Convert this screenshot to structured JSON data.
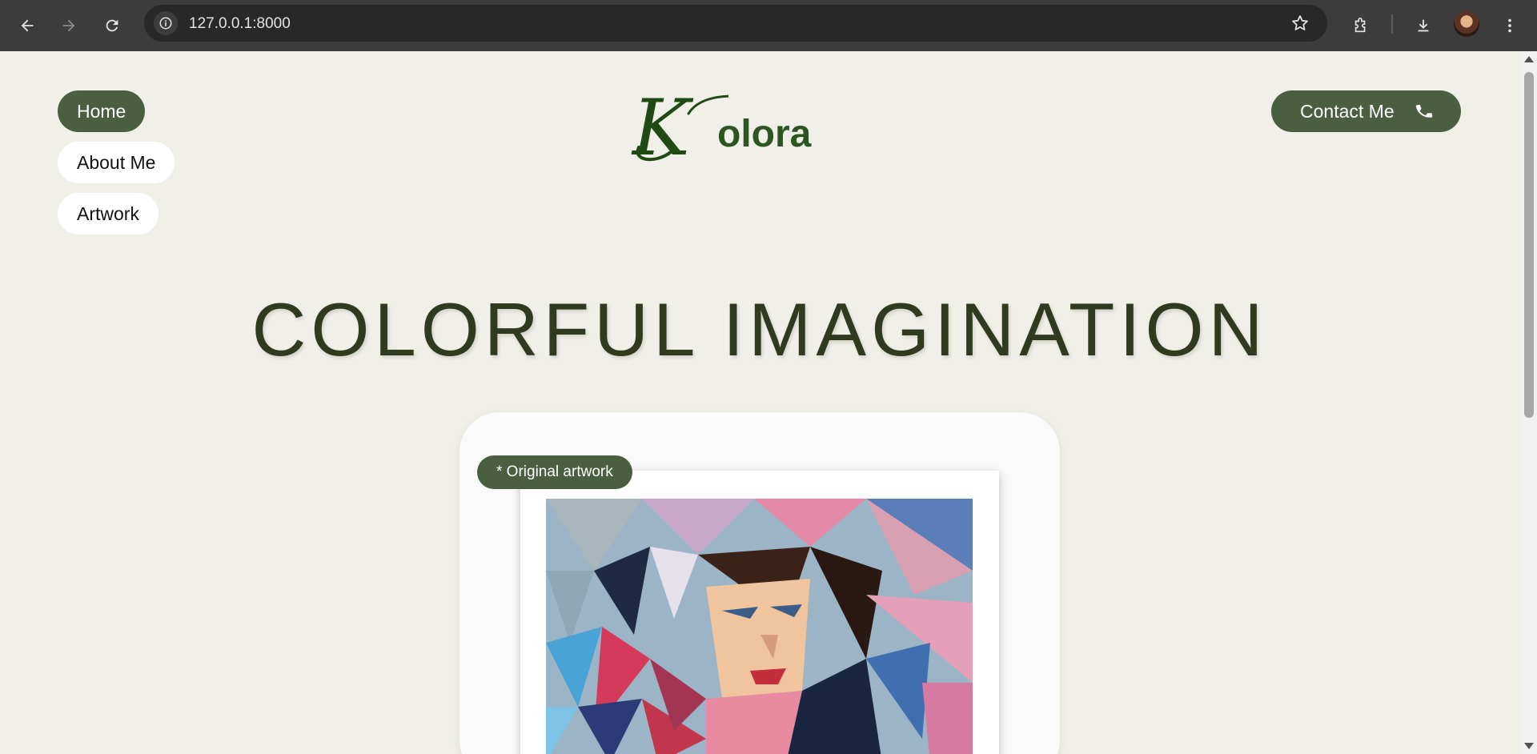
{
  "browser": {
    "url": "127.0.0.1:8000"
  },
  "nav": {
    "items": [
      {
        "label": "Home",
        "active": true
      },
      {
        "label": "About Me",
        "active": false
      },
      {
        "label": "Artwork",
        "active": false
      }
    ]
  },
  "logo": {
    "initial": "K",
    "rest": "olora"
  },
  "contact": {
    "label": "Contact Me",
    "icon": "phone-icon"
  },
  "hero": {
    "title": "COLORFUL IMAGINATION"
  },
  "artwork": {
    "badge": "* Original artwork"
  },
  "colors": {
    "background": "#f1f0e8",
    "accent": "#4a5e40",
    "title": "#2f3a1e",
    "logo": "#2c5522"
  }
}
